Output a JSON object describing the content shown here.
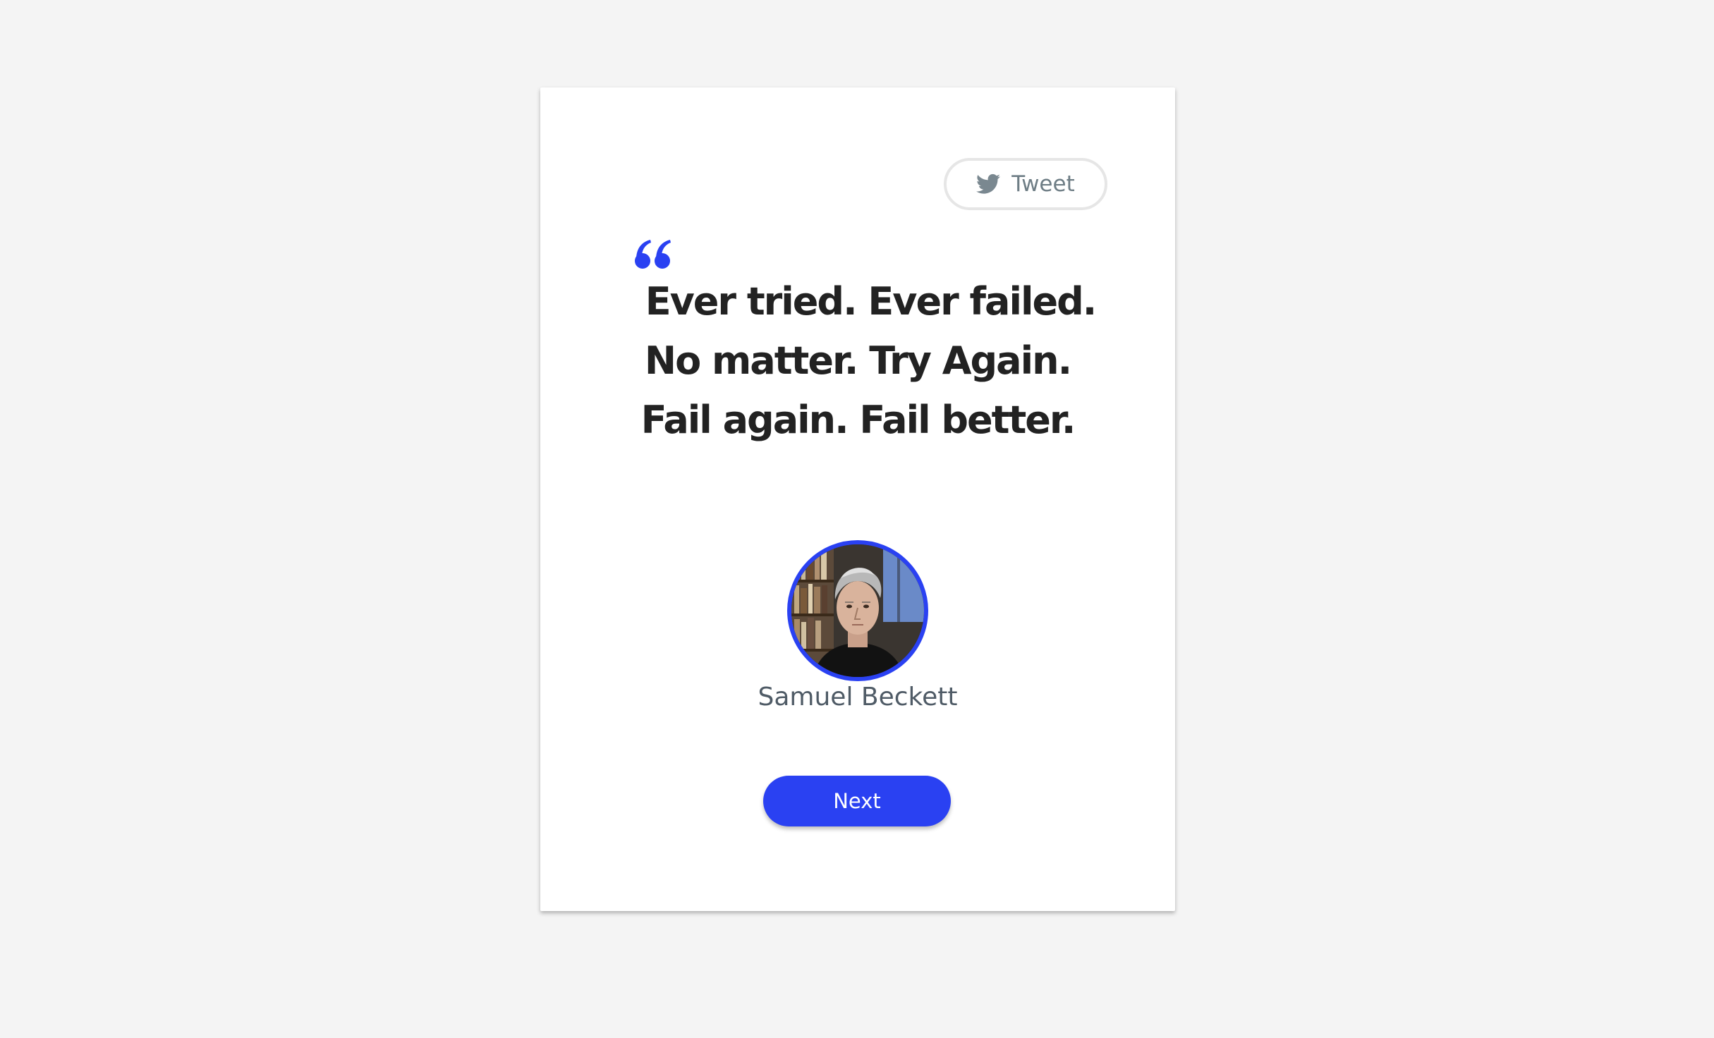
{
  "tweet": {
    "label": "Tweet",
    "icon": "twitter-bird-icon"
  },
  "quote": {
    "icon": "quote-mark-icon",
    "text": "Ever tried. Ever failed. No matter. Try Again. Fail again. Fail better."
  },
  "author": {
    "name": "Samuel Beckett",
    "avatar_icon": "author-portrait"
  },
  "next": {
    "label": "Next"
  },
  "colors": {
    "accent": "#2a41f2",
    "background": "#f4f4f4",
    "card": "#ffffff",
    "quote_text": "#222222",
    "author_text": "#4f5b66",
    "tweet_text": "#6e7d85"
  }
}
